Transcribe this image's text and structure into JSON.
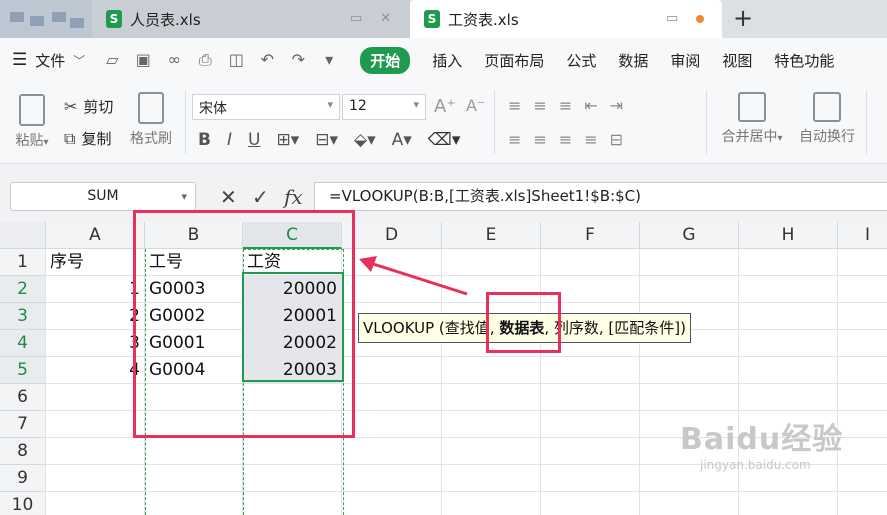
{
  "tabs": [
    {
      "label": "人员表.xls"
    },
    {
      "label": "工资表.xls"
    }
  ],
  "sheet_icon_letter": "S",
  "new_tab_symbol": "+",
  "menu": {
    "file_label": "文件",
    "start_label": "开始",
    "items": [
      "插入",
      "页面布局",
      "公式",
      "数据",
      "审阅",
      "视图",
      "特色功能"
    ]
  },
  "ribbon": {
    "paste": "粘贴",
    "cut": "剪切",
    "copy": "复制",
    "format_painter": "格式刷",
    "font_name": "宋体",
    "font_size": "12",
    "merge_center": "合并居中",
    "auto_wrap": "自动换行",
    "bold": "B",
    "italic": "I",
    "underline": "U"
  },
  "formula_bar": {
    "name_box": "SUM",
    "cancel": "✕",
    "confirm": "✓",
    "fx": "fx",
    "formula": "=VLOOKUP(B:B,[工资表.xls]Sheet1!$B:$C)"
  },
  "columns": [
    "A",
    "B",
    "C",
    "D",
    "E",
    "F",
    "G",
    "H",
    "I"
  ],
  "rows": [
    "1",
    "2",
    "3",
    "4",
    "5",
    "6",
    "7",
    "8",
    "9",
    "10"
  ],
  "cells": {
    "A1": "序号",
    "B1": "工号",
    "C1": "工资",
    "A2": "1",
    "B2": "G0003",
    "C2": "20000",
    "A3": "2",
    "B3": "G0002",
    "C3": "20001",
    "A4": "3",
    "B4": "G0001",
    "C4": "20002",
    "A5": "4",
    "B5": "G0004",
    "C5": "20003"
  },
  "tooltip": {
    "prefix": "VLOOKUP (查找值, ",
    "bold": "数据表",
    "suffix": ", 列序数, [匹配条件])"
  },
  "watermark": {
    "brand": "Baidu经验",
    "url": "jingyan.baidu.com"
  },
  "colors": {
    "accent_green": "#1f9a4e",
    "annotation_red": "#ea2f5b"
  }
}
